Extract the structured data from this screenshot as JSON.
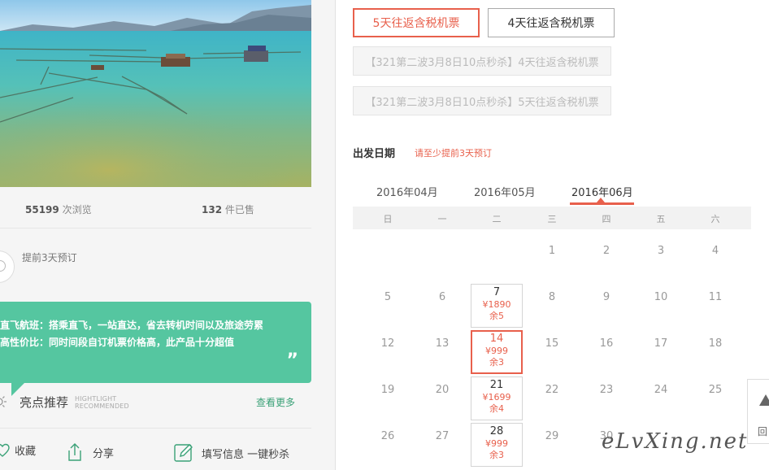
{
  "stats": {
    "views_num": "55199",
    "views_label": "次浏览",
    "sold_num": "132",
    "sold_label": "件已售"
  },
  "advance_booking": {
    "text": "提前3天预订"
  },
  "highlights": {
    "items": [
      {
        "label": "直飞航班：",
        "text": "搭乘直飞，一站直达，省去转机时间以及旅途劳累"
      },
      {
        "label": "高性价比：",
        "text": "同时间段自订机票价格高，此产品十分超值"
      }
    ],
    "quote": "”",
    "title": "亮点推荐",
    "title_en_1": "HIGHTLIGHT",
    "title_en_2": "RECOMMENDED",
    "more": "查看更多"
  },
  "actions": {
    "favorite": "收藏",
    "share": "分享",
    "flash_sale": "填写信息 一键秒杀"
  },
  "products": [
    {
      "label": "5天往返含税机票",
      "state": "selected"
    },
    {
      "label": "4天往返含税机票",
      "state": "normal"
    },
    {
      "label": "【321第二波3月8日10点秒杀】4天往返含税机票",
      "state": "disabled"
    },
    {
      "label": "【321第二波3月8日10点秒杀】5天往返含税机票",
      "state": "disabled"
    }
  ],
  "departure": {
    "label": "出发日期",
    "note": "请至少提前3天预订"
  },
  "months": [
    "2016年04月",
    "2016年05月",
    "2016年06月"
  ],
  "active_month": "2016年06月",
  "weekdays": [
    "日",
    "一",
    "二",
    "三",
    "四",
    "五",
    "六"
  ],
  "calendar": [
    {
      "day": "1"
    },
    {
      "day": "2"
    },
    {
      "day": "3"
    },
    {
      "day": "4"
    },
    {
      "day": "5"
    },
    {
      "day": "6"
    },
    {
      "day": "7",
      "price": "¥1890",
      "left": "余5"
    },
    {
      "day": "8"
    },
    {
      "day": "9"
    },
    {
      "day": "10"
    },
    {
      "day": "11"
    },
    {
      "day": "12"
    },
    {
      "day": "13"
    },
    {
      "day": "14",
      "price": "¥999",
      "left": "余3",
      "selected": true
    },
    {
      "day": "15"
    },
    {
      "day": "16"
    },
    {
      "day": "17"
    },
    {
      "day": "18"
    },
    {
      "day": "19"
    },
    {
      "day": "20"
    },
    {
      "day": "21",
      "price": "¥1699",
      "left": "余4"
    },
    {
      "day": "22"
    },
    {
      "day": "23"
    },
    {
      "day": "24"
    },
    {
      "day": "25"
    },
    {
      "day": "26"
    },
    {
      "day": "27"
    },
    {
      "day": "28",
      "price": "¥999",
      "left": "余3"
    },
    {
      "day": "29"
    },
    {
      "day": "30"
    }
  ],
  "back_to_top": {
    "label": "回"
  },
  "watermark": "eLvXing.net",
  "colors": {
    "accent": "#e8604c",
    "green": "#55c6a0",
    "link_green": "#3aa177"
  }
}
